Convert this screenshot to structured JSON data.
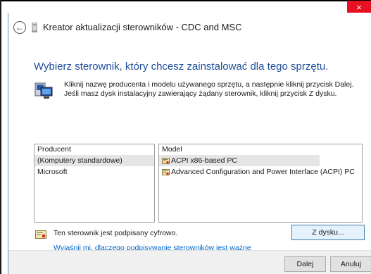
{
  "window": {
    "title": "Kreator aktualizacji sterowników - CDC and MSC",
    "close_label": "×",
    "back_label": "←"
  },
  "main": {
    "heading": "Wybierz sterownik, który chcesz zainstalować dla tego sprzętu.",
    "instruction": "Kliknij nazwę producenta i modelu używanego sprzętu, a następnie kliknij przycisk Dalej. Jeśli masz dysk instalacyjny zawierający żądany sterownik, kliknij przycisk Z dysku."
  },
  "producer_list": {
    "header": "Producent",
    "items": [
      {
        "label": "(Komputery standardowe)",
        "selected": true
      },
      {
        "label": "Microsoft",
        "selected": false
      }
    ]
  },
  "model_list": {
    "header": "Model",
    "items": [
      {
        "label": "ACPI x86-based PC",
        "selected": true
      },
      {
        "label": "Advanced Configuration and Power Interface (ACPI) PC",
        "selected": false
      }
    ]
  },
  "signature": {
    "text": "Ten sterownik jest podpisany cyfrowo.",
    "link": "Wyjaśnij mi, dlaczego podpisywanie sterowników jest ważne"
  },
  "buttons": {
    "have_disk": "Z dysku...",
    "next": "Dalej",
    "cancel": "Anuluj"
  },
  "colors": {
    "heading": "#1f4e9b",
    "link": "#0066cc",
    "close": "#e81123"
  }
}
